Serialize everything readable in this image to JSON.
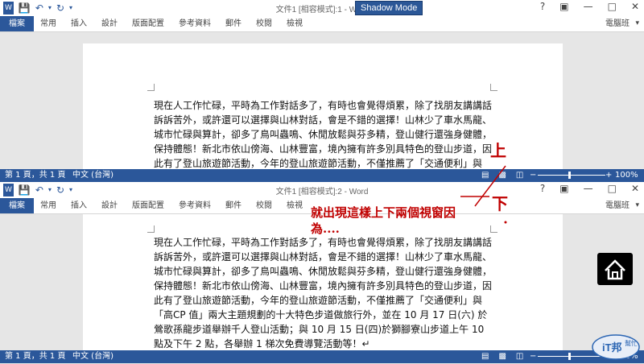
{
  "top": {
    "title": "文件1 [相容模式]:1 - Word",
    "user": "電腦班",
    "zoom": "100%"
  },
  "bottom": {
    "title": "文件1 [相容模式]:2 - Word",
    "user": "電腦班",
    "zoom": "100%"
  },
  "shadow_mode_label": "Shadow Mode",
  "ribbon": {
    "file_tab": "檔案",
    "tabs": [
      "常用",
      "插入",
      "設計",
      "版面配置",
      "參考資料",
      "郵件",
      "校閱",
      "檢視"
    ]
  },
  "status": {
    "page": "第 1 頁，共 1 頁",
    "language": "中文 (台灣)"
  },
  "document": {
    "top_text": "現在人工作忙碌，平時為工作對話多了，有時也會覺得煩累，除了找朋友講講話訴訴苦外，或許還可以選擇與山林對話，會是不錯的選擇！山林少了車水馬龍、城市忙碌與算計，卻多了鳥叫蟲鳴、休閒放鬆與芬多精，登山健行還強身健體，保持體態！新北市依山傍海、山林豐富，境內擁有許多別具特色的登山步道，因此有了登山旅遊節活動，今年的登山旅遊節活動，不僅推薦了「交通便利」與「高",
    "bottom_text": "現在人工作忙碌，平時為工作對話多了，有時也會覺得煩累，除了找朋友講講話訴訴苦外，或許還可以選擇與山林對話，會是不錯的選擇！山林少了車水馬龍、城市忙碌與算計，卻多了鳥叫蟲鳴、休閒放鬆與芬多精，登山健行還強身健體，保持體態！新北市依山傍海、山林豐富，境內擁有許多別具特色的登山步道，因此有了登山旅遊節活動，今年的登山旅遊節活動，不僅推薦了「交通便利」與「高CP 值」兩大主題規劃的十大特色步道做旅行外，並在 10 月 17 日(六) 於鶯歌孫龍步道舉辦千人登山活動；與 10 月 15 日(四)於獅腳寮山步道上午 10 點及下午 2 點，各舉辦 1 梯次免費導覽活動等！↵"
  },
  "annotations": {
    "up_label": "上",
    "down_label": "下",
    "note": "就出現這樣上下兩個視窗因為....",
    "color": "#c00000"
  },
  "colors": {
    "accent": "#2b579a"
  },
  "logo": {
    "line1": "iT邦",
    "line2": "幫忙"
  }
}
